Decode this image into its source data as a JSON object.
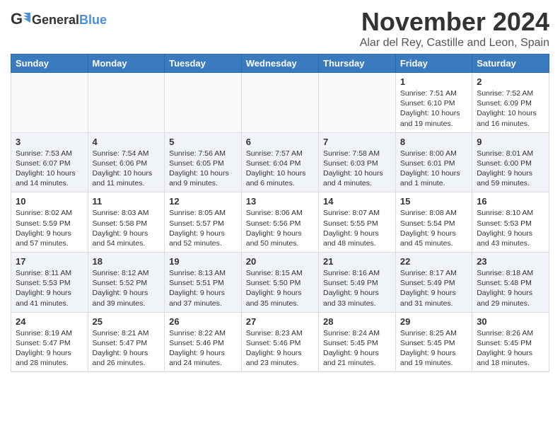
{
  "logo": {
    "general": "General",
    "blue": "Blue"
  },
  "title": "November 2024",
  "subtitle": "Alar del Rey, Castille and Leon, Spain",
  "weekdays": [
    "Sunday",
    "Monday",
    "Tuesday",
    "Wednesday",
    "Thursday",
    "Friday",
    "Saturday"
  ],
  "weeks": [
    [
      {
        "day": "",
        "info": ""
      },
      {
        "day": "",
        "info": ""
      },
      {
        "day": "",
        "info": ""
      },
      {
        "day": "",
        "info": ""
      },
      {
        "day": "",
        "info": ""
      },
      {
        "day": "1",
        "info": "Sunrise: 7:51 AM\nSunset: 6:10 PM\nDaylight: 10 hours and 19 minutes."
      },
      {
        "day": "2",
        "info": "Sunrise: 7:52 AM\nSunset: 6:09 PM\nDaylight: 10 hours and 16 minutes."
      }
    ],
    [
      {
        "day": "3",
        "info": "Sunrise: 7:53 AM\nSunset: 6:07 PM\nDaylight: 10 hours and 14 minutes."
      },
      {
        "day": "4",
        "info": "Sunrise: 7:54 AM\nSunset: 6:06 PM\nDaylight: 10 hours and 11 minutes."
      },
      {
        "day": "5",
        "info": "Sunrise: 7:56 AM\nSunset: 6:05 PM\nDaylight: 10 hours and 9 minutes."
      },
      {
        "day": "6",
        "info": "Sunrise: 7:57 AM\nSunset: 6:04 PM\nDaylight: 10 hours and 6 minutes."
      },
      {
        "day": "7",
        "info": "Sunrise: 7:58 AM\nSunset: 6:03 PM\nDaylight: 10 hours and 4 minutes."
      },
      {
        "day": "8",
        "info": "Sunrise: 8:00 AM\nSunset: 6:01 PM\nDaylight: 10 hours and 1 minute."
      },
      {
        "day": "9",
        "info": "Sunrise: 8:01 AM\nSunset: 6:00 PM\nDaylight: 9 hours and 59 minutes."
      }
    ],
    [
      {
        "day": "10",
        "info": "Sunrise: 8:02 AM\nSunset: 5:59 PM\nDaylight: 9 hours and 57 minutes."
      },
      {
        "day": "11",
        "info": "Sunrise: 8:03 AM\nSunset: 5:58 PM\nDaylight: 9 hours and 54 minutes."
      },
      {
        "day": "12",
        "info": "Sunrise: 8:05 AM\nSunset: 5:57 PM\nDaylight: 9 hours and 52 minutes."
      },
      {
        "day": "13",
        "info": "Sunrise: 8:06 AM\nSunset: 5:56 PM\nDaylight: 9 hours and 50 minutes."
      },
      {
        "day": "14",
        "info": "Sunrise: 8:07 AM\nSunset: 5:55 PM\nDaylight: 9 hours and 48 minutes."
      },
      {
        "day": "15",
        "info": "Sunrise: 8:08 AM\nSunset: 5:54 PM\nDaylight: 9 hours and 45 minutes."
      },
      {
        "day": "16",
        "info": "Sunrise: 8:10 AM\nSunset: 5:53 PM\nDaylight: 9 hours and 43 minutes."
      }
    ],
    [
      {
        "day": "17",
        "info": "Sunrise: 8:11 AM\nSunset: 5:53 PM\nDaylight: 9 hours and 41 minutes."
      },
      {
        "day": "18",
        "info": "Sunrise: 8:12 AM\nSunset: 5:52 PM\nDaylight: 9 hours and 39 minutes."
      },
      {
        "day": "19",
        "info": "Sunrise: 8:13 AM\nSunset: 5:51 PM\nDaylight: 9 hours and 37 minutes."
      },
      {
        "day": "20",
        "info": "Sunrise: 8:15 AM\nSunset: 5:50 PM\nDaylight: 9 hours and 35 minutes."
      },
      {
        "day": "21",
        "info": "Sunrise: 8:16 AM\nSunset: 5:49 PM\nDaylight: 9 hours and 33 minutes."
      },
      {
        "day": "22",
        "info": "Sunrise: 8:17 AM\nSunset: 5:49 PM\nDaylight: 9 hours and 31 minutes."
      },
      {
        "day": "23",
        "info": "Sunrise: 8:18 AM\nSunset: 5:48 PM\nDaylight: 9 hours and 29 minutes."
      }
    ],
    [
      {
        "day": "24",
        "info": "Sunrise: 8:19 AM\nSunset: 5:47 PM\nDaylight: 9 hours and 28 minutes."
      },
      {
        "day": "25",
        "info": "Sunrise: 8:21 AM\nSunset: 5:47 PM\nDaylight: 9 hours and 26 minutes."
      },
      {
        "day": "26",
        "info": "Sunrise: 8:22 AM\nSunset: 5:46 PM\nDaylight: 9 hours and 24 minutes."
      },
      {
        "day": "27",
        "info": "Sunrise: 8:23 AM\nSunset: 5:46 PM\nDaylight: 9 hours and 23 minutes."
      },
      {
        "day": "28",
        "info": "Sunrise: 8:24 AM\nSunset: 5:45 PM\nDaylight: 9 hours and 21 minutes."
      },
      {
        "day": "29",
        "info": "Sunrise: 8:25 AM\nSunset: 5:45 PM\nDaylight: 9 hours and 19 minutes."
      },
      {
        "day": "30",
        "info": "Sunrise: 8:26 AM\nSunset: 5:45 PM\nDaylight: 9 hours and 18 minutes."
      }
    ]
  ]
}
